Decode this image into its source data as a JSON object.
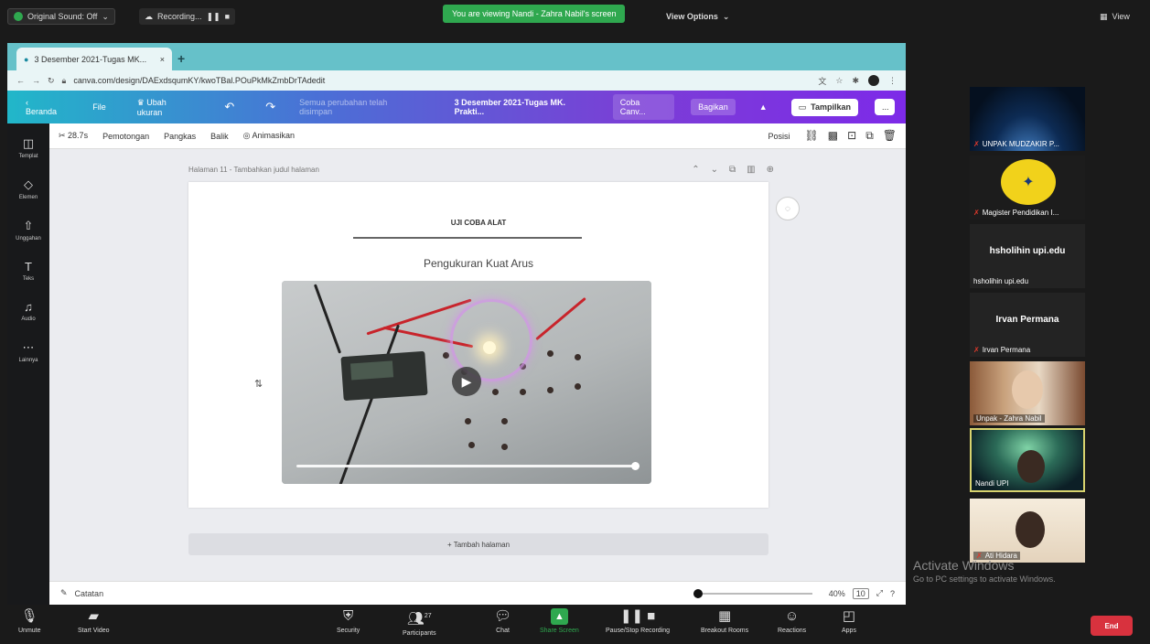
{
  "zoom_top": {
    "sound_label": "Original Sound: Off",
    "recording_label": "Recording...",
    "viewing_banner": "You are viewing Nandi - Zahra Nabil's screen",
    "view_options": "View Options",
    "view_label": "View"
  },
  "browser": {
    "tab_title": "3 Desember 2021-Tugas MK...",
    "url": "canva.com/design/DAExdsqumKY/kwoTBal.POuPkMkZmbDrTAdedit"
  },
  "canva_bar": {
    "home": "Beranda",
    "file": "File",
    "resize": "Ubah ukuran",
    "saved_status": "Semua perubahan telah disimpan",
    "doc_title": "3 Desember 2021-Tugas MK. Prakti...",
    "share_dropdown": "Coba Canv...",
    "share": "Bagikan",
    "present": "Tampilkan",
    "more": "..."
  },
  "side_rail": [
    {
      "icon": "template-icon",
      "glyph": "◫",
      "label": "Templat"
    },
    {
      "icon": "elements-icon",
      "glyph": "◇",
      "label": "Elemen"
    },
    {
      "icon": "upload-icon",
      "glyph": "⇧",
      "label": "Unggahan"
    },
    {
      "icon": "text-icon",
      "glyph": "T",
      "label": "Teks"
    },
    {
      "icon": "audio-icon",
      "glyph": "♫",
      "label": "Audio"
    },
    {
      "icon": "more-icon",
      "glyph": "⋯",
      "label": "Lainnya"
    }
  ],
  "edit_toolbar": {
    "trim": "28.7s",
    "adjust": "Pemotongan",
    "flip": "Pangkas",
    "flip2": "Balik",
    "animate": "Animasikan",
    "position": "Posisi"
  },
  "page": {
    "header": "Halaman 11 - Tambahkan judul halaman",
    "heading": "UJI COBA ALAT",
    "title": "Pengukuran Kuat Arus",
    "add_page": "+ Tambah halaman"
  },
  "footer": {
    "notes": "Catatan",
    "zoom": "40%",
    "page_count": "10"
  },
  "participants": [
    {
      "name": "UNPAK MUDZAKIR P...",
      "type": "image"
    },
    {
      "name": "Magister Pendidikan I...",
      "type": "logo"
    },
    {
      "display": "hsholihin upi.edu",
      "name": "hsholihin upi.edu"
    },
    {
      "display": "Irvan Permana",
      "name": "Irvan Permana"
    },
    {
      "name": "Unpak - Zahra Nabil",
      "type": "video"
    },
    {
      "name": "Nandi UPI",
      "type": "video"
    },
    {
      "name": "Ati Hidara",
      "type": "video"
    }
  ],
  "activate_windows": {
    "line1": "Activate Windows",
    "line2": "Go to PC settings to activate Windows."
  },
  "zoom_bottom": {
    "unmute": "Unmute",
    "start_video": "Start Video",
    "security": "Security",
    "participants": "Participants",
    "participants_count": "27",
    "chat": "Chat",
    "share_screen": "Share Screen",
    "pause_recording": "Pause/Stop Recording",
    "breakout": "Breakout Rooms",
    "reactions": "Reactions",
    "apps": "Apps",
    "end": "End"
  }
}
